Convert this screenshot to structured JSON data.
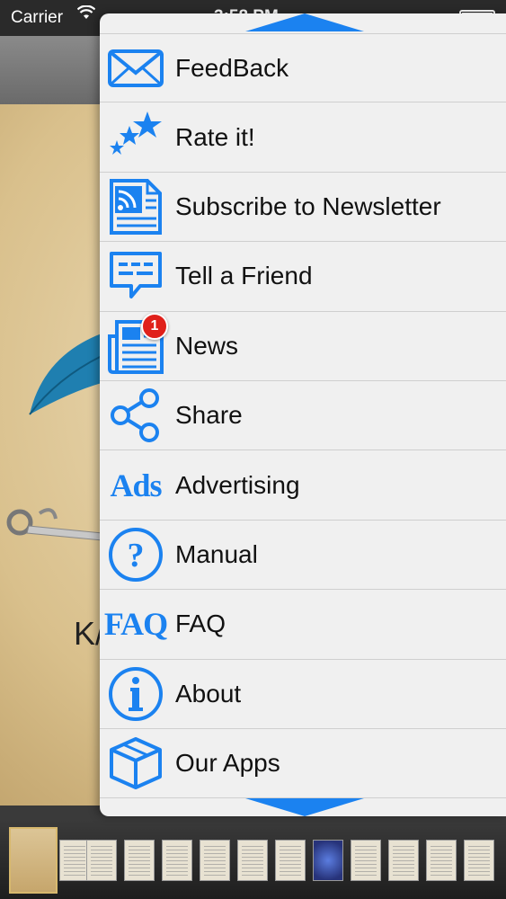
{
  "status_bar": {
    "carrier": "Carrier",
    "time": "3:58 PM"
  },
  "book": {
    "visible_letter": "K/"
  },
  "menu": {
    "accent_color": "#1b82f0",
    "items": [
      {
        "label": "FeedBack",
        "icon": "envelope-icon"
      },
      {
        "label": "Rate it!",
        "icon": "stars-icon"
      },
      {
        "label": "Subscribe to Newsletter",
        "icon": "rss-document-icon"
      },
      {
        "label": "Tell a Friend",
        "icon": "speech-bubble-icon"
      },
      {
        "label": "News",
        "icon": "newspaper-icon",
        "badge": "1"
      },
      {
        "label": "Share",
        "icon": "share-icon"
      },
      {
        "label": "Advertising",
        "icon": "ads-text-icon",
        "icon_text": "Ads"
      },
      {
        "label": "Manual",
        "icon": "question-circle-icon"
      },
      {
        "label": "FAQ",
        "icon": "faq-text-icon",
        "icon_text": "FAQ"
      },
      {
        "label": "About",
        "icon": "info-circle-icon"
      },
      {
        "label": "Our Apps",
        "icon": "box-icon"
      }
    ]
  }
}
